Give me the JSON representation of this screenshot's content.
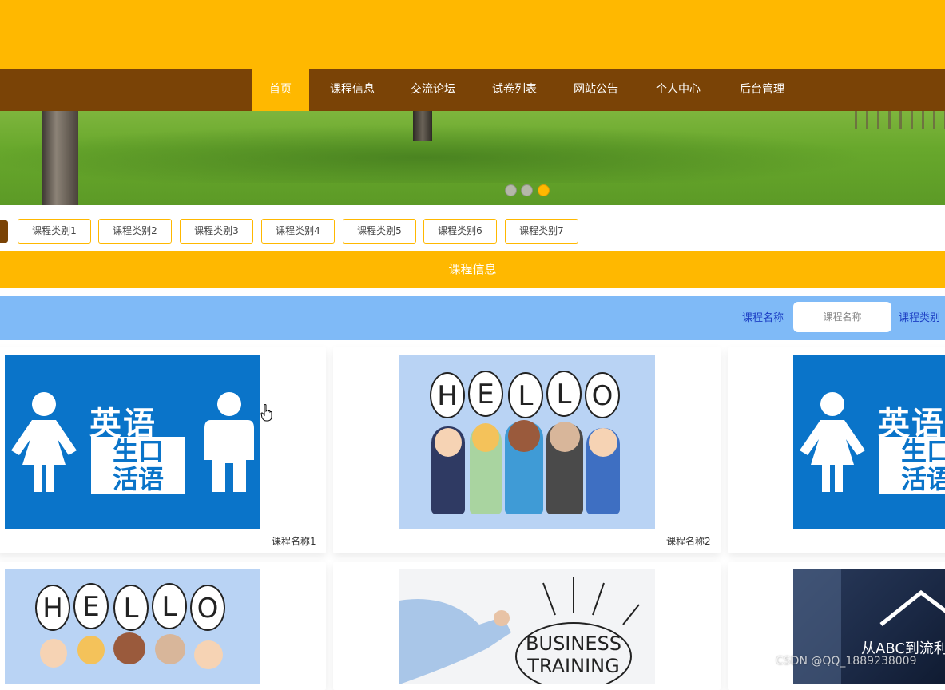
{
  "nav": {
    "items": [
      {
        "label": "首页",
        "active": true
      },
      {
        "label": "课程信息"
      },
      {
        "label": "交流论坛"
      },
      {
        "label": "试卷列表"
      },
      {
        "label": "网站公告"
      },
      {
        "label": "个人中心"
      },
      {
        "label": "后台管理"
      }
    ]
  },
  "banner": {
    "slide_count": 3,
    "active_slide": 3
  },
  "categories": [
    "课程类别1",
    "课程类别2",
    "课程类别3",
    "课程类别4",
    "课程类别5",
    "课程类别6",
    "课程类别7"
  ],
  "section": {
    "title": "课程信息"
  },
  "search": {
    "name_label": "课程名称",
    "name_placeholder": "课程名称",
    "category_label": "课程类别"
  },
  "courses": [
    {
      "title": "课程名称1",
      "image": "english-spoken-poster",
      "image_text": [
        "英语",
        "生口",
        "活语"
      ]
    },
    {
      "title": "课程名称2",
      "image": "hello-kids-illustration",
      "image_text": [
        "H",
        "E",
        "L",
        "L",
        "O"
      ]
    },
    {
      "title": "",
      "image": "english-spoken-poster",
      "image_text": [
        "英语",
        "生口",
        "活语"
      ]
    },
    {
      "title": "",
      "image": "hello-kids-illustration",
      "image_text": [
        "H",
        "E",
        "L",
        "L",
        "O"
      ]
    },
    {
      "title": "",
      "image": "business-training-photo",
      "image_text": [
        "BUSINESS",
        "TRAINING"
      ]
    },
    {
      "title": "",
      "image": "abc-poster",
      "image_text": [
        "从ABC到流利"
      ]
    }
  ],
  "watermark": "CSDN @QQ_1889238009",
  "colors": {
    "primary": "#ffb800",
    "nav": "#7a4306",
    "search_bar": "#7fbaf7",
    "label": "#1c3fc4"
  }
}
